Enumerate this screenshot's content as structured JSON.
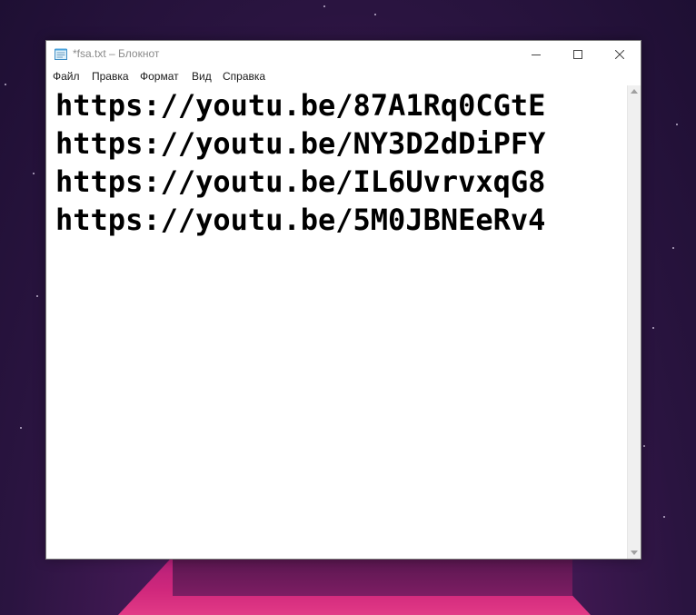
{
  "window": {
    "title": "*fsa.txt – Блокнот",
    "icon": "notepad-icon"
  },
  "menu": {
    "items": [
      "Файл",
      "Правка",
      "Формат",
      "Вид",
      "Справка"
    ]
  },
  "editor": {
    "lines": [
      "https://youtu.be/87A1Rq0CGtE",
      "https://youtu.be/NY3D2dDiPFY",
      "https://youtu.be/IL6UvrvxqG8",
      "https://youtu.be/5M0JBNEeRv4"
    ]
  }
}
